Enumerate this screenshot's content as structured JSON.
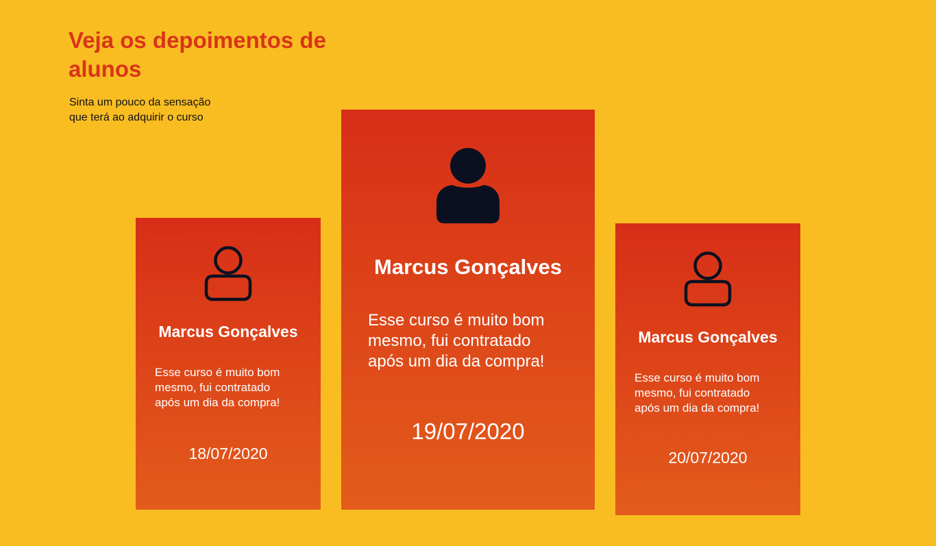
{
  "section": {
    "title": "Veja os depoimentos de alunos",
    "subtitle": "Sinta um pouco da sensação\nque terá ao adquirir o curso"
  },
  "colors": {
    "background": "#F9BD22",
    "title": "#D93418",
    "card_gradient_top": "#D72E17",
    "card_gradient_bottom": "#E35C1B",
    "icon": "#0B1020"
  },
  "testimonials": [
    {
      "name": "Marcus Gonçalves",
      "text": "Esse curso é muito bom\nmesmo, fui contratado\napós um dia da compra!",
      "date": "18/07/2020",
      "icon": "user-outline-icon"
    },
    {
      "name": "Marcus Gonçalves",
      "text": "Esse curso é muito bom\nmesmo, fui contratado\napós um dia da compra!",
      "date": "19/07/2020",
      "icon": "user-filled-icon"
    },
    {
      "name": "Marcus Gonçalves",
      "text": "Esse curso é muito bom\nmesmo, fui contratado\napós um dia da compra!",
      "date": "20/07/2020",
      "icon": "user-outline-icon"
    }
  ]
}
